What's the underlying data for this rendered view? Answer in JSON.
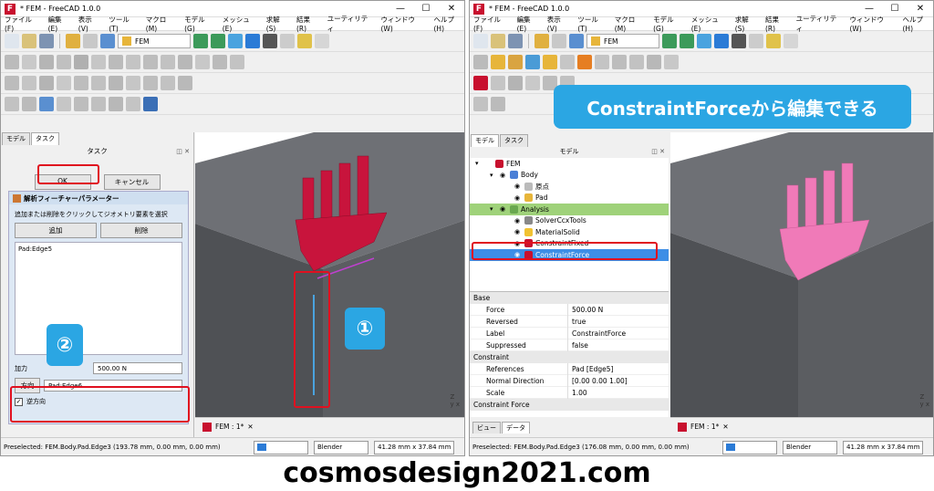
{
  "caption": "cosmosdesign2021.com",
  "left": {
    "title": "* FEM - FreeCAD 1.0.0",
    "menus": [
      "ファイル(F)",
      "編集(E)",
      "表示(V)",
      "ツール(T)",
      "マクロ(M)",
      "モデル(G)",
      "メッシュ(E)",
      "求解(S)",
      "結果(R)",
      "ユーティリティ",
      "ウィンドウ(W)",
      "ヘルプ(H)"
    ],
    "workbench": "FEM",
    "tabs": [
      "モデル",
      "タスク"
    ],
    "panel_title": "タスク",
    "ok": "OK",
    "cancel": "キャンセル",
    "section_title": "解析フィーチャーパラメーター",
    "instruction": "追加または削除をクリックしてジオメトリ要素を選択",
    "add": "追加",
    "remove": "削除",
    "list_item": "Pad:Edge5",
    "force_label": "加力",
    "force_value": "500.00 N",
    "dir_button": "方向",
    "dir_value": "Pad:Edge6",
    "reverse_label": "逆方向",
    "badge1": "①",
    "badge2": "②",
    "doc_tab": "FEM : 1*",
    "status": "Preselected: FEM.Body.Pad.Edge3 (193.78 mm, 0.00 mm, 0.00 mm)",
    "nav": "Blender",
    "dims": "41.28 mm x 37.84 mm"
  },
  "right": {
    "title": "* FEM - FreeCAD 1.0.0",
    "banner": "ConstraintForceから編集できる",
    "tabs": [
      "モデル",
      "タスク"
    ],
    "panel_title": "モデル",
    "tree": [
      {
        "label": "FEM",
        "indent": 0,
        "color": "#c8102e"
      },
      {
        "label": "Body",
        "indent": 1,
        "color": "#4a7fd6"
      },
      {
        "label": "原点",
        "indent": 2,
        "color": "#bbbbbb"
      },
      {
        "label": "Pad",
        "indent": 2,
        "color": "#e7b53a"
      },
      {
        "label": "Analysis",
        "indent": 1,
        "color": "#6aa84f"
      },
      {
        "label": "SolverCcxTools",
        "indent": 2,
        "color": "#888888"
      },
      {
        "label": "MaterialSolid",
        "indent": 2,
        "color": "#f1c232"
      },
      {
        "label": "ConstraintFixed",
        "indent": 2,
        "color": "#c8102e"
      },
      {
        "label": "ConstraintForce",
        "indent": 2,
        "color": "#c8102e"
      }
    ],
    "props": [
      {
        "group": "Base"
      },
      {
        "k": "Force",
        "v": "500.00 N"
      },
      {
        "k": "Reversed",
        "v": "true"
      },
      {
        "k": "Label",
        "v": "ConstraintForce"
      },
      {
        "k": "Suppressed",
        "v": "false"
      },
      {
        "group": "Constraint"
      },
      {
        "k": "References",
        "v": "Pad [Edge5]"
      },
      {
        "k": "Normal Direction",
        "v": "[0.00 0.00 1.00]"
      },
      {
        "k": "Scale",
        "v": "1.00"
      },
      {
        "group": "Constraint Force"
      }
    ],
    "ptabs": [
      "ビュー",
      "データ"
    ],
    "doc_tab": "FEM : 1*",
    "status": "Preselected: FEM.Body.Pad.Edge3 (176.08 mm, 0.00 mm, 0.00 mm)",
    "nav": "Blender",
    "dims": "41.28 mm x 37.84 mm"
  },
  "colors": {
    "accent": "#2ba6e3",
    "highlight": "#e0101f",
    "force_red": "#c8143c",
    "force_pink": "#f07ab8",
    "block": "#5b5d61"
  }
}
